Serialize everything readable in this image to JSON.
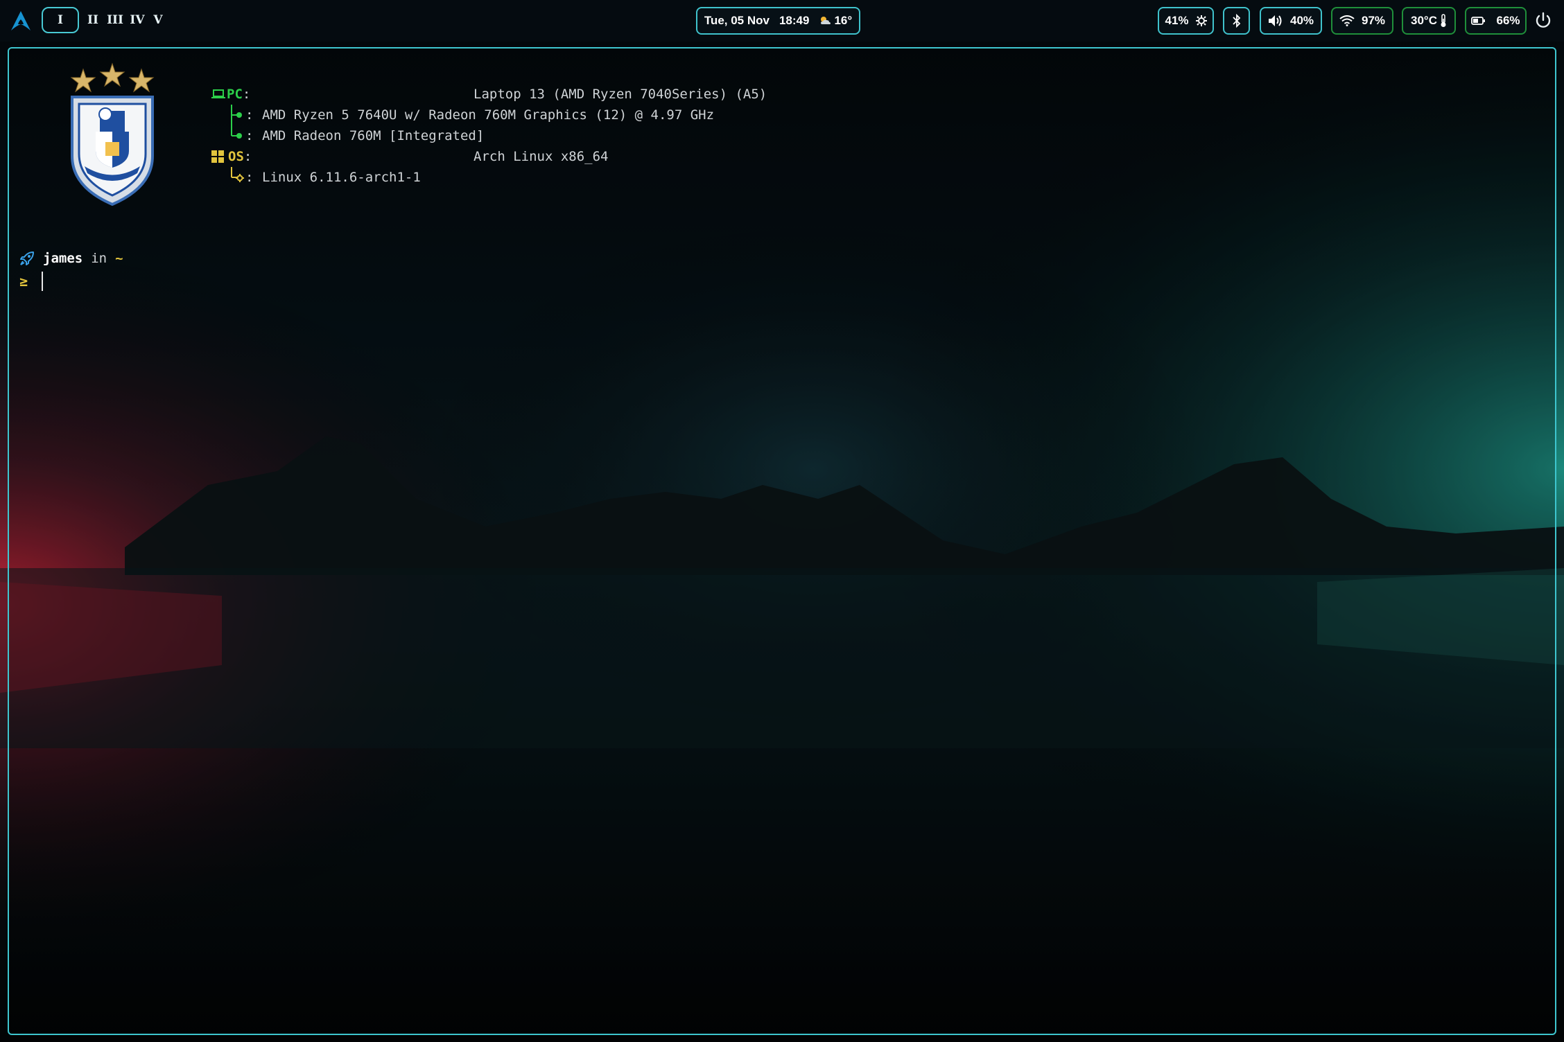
{
  "topbar": {
    "workspaces": [
      "I",
      "II",
      "III",
      "IV",
      "V"
    ],
    "active_workspace": "I",
    "clock": {
      "date": "Tue, 05 Nov",
      "time": "18:49",
      "weather": "16°",
      "weather_icon": "partly-cloudy-icon"
    },
    "brightness": {
      "value": "41%",
      "icon": "brightness-icon"
    },
    "bluetooth": {
      "icon": "bluetooth-icon"
    },
    "volume": {
      "value": "40%",
      "icon": "speaker-icon"
    },
    "wifi": {
      "value": "97%",
      "icon": "wifi-icon"
    },
    "temperature": {
      "value": "30°C",
      "icon": "thermometer-icon"
    },
    "battery": {
      "value": "66%",
      "icon": "battery-icon"
    },
    "power_icon": "power-icon"
  },
  "fastfetch": {
    "pc_key": "PC",
    "pc_value": "Laptop 13 (AMD Ryzen 7040Series) (A5)",
    "cpu_value": "AMD Ryzen 5 7640U w/ Radeon 760M Graphics (12) @ 4.97 GHz",
    "gpu_value": "AMD Radeon 760M [Integrated]",
    "os_key": "OS",
    "os_value": "Arch Linux x86_64",
    "kernel_value": "Linux 6.11.6-arch1-1",
    "separator": ":"
  },
  "prompt": {
    "user": "james",
    "in": "in",
    "dir": "~",
    "symbol": "≥"
  },
  "colors": {
    "accent": "#3ec6cf",
    "pc_green": "#2ccf4a",
    "os_yellow": "#e2c43d",
    "green_border": "#1f8f3a"
  }
}
